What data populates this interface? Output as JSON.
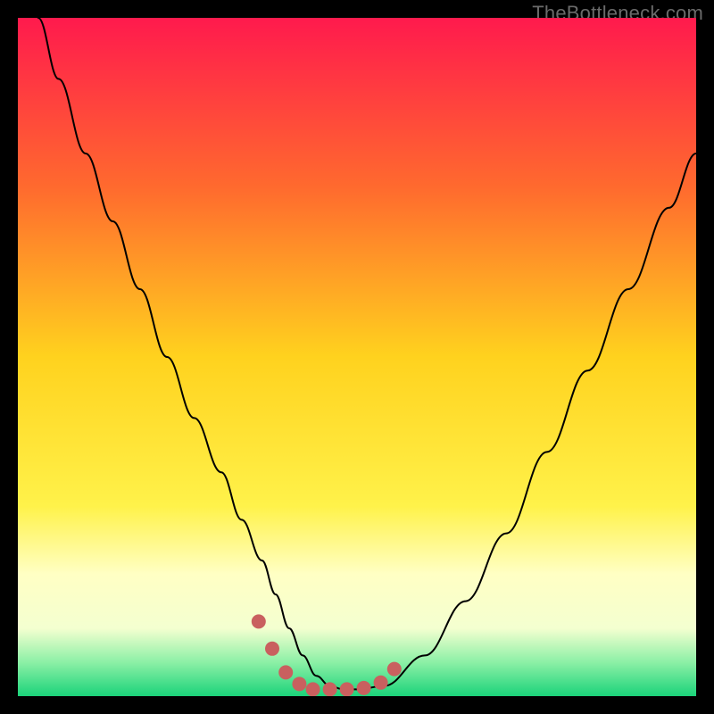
{
  "watermark": "TheBottleneck.com",
  "chart_data": {
    "type": "line",
    "title": "",
    "xlabel": "",
    "ylabel": "",
    "xlim": [
      0,
      100
    ],
    "ylim": [
      0,
      100
    ],
    "grid": false,
    "legend": false,
    "background_gradient": [
      {
        "pos": 0.0,
        "color": "#ff1a4d"
      },
      {
        "pos": 0.25,
        "color": "#ff6a2e"
      },
      {
        "pos": 0.5,
        "color": "#ffd21e"
      },
      {
        "pos": 0.72,
        "color": "#fff24a"
      },
      {
        "pos": 0.82,
        "color": "#ffffc4"
      },
      {
        "pos": 0.9,
        "color": "#f4ffd0"
      },
      {
        "pos": 0.95,
        "color": "#8cf0a6"
      },
      {
        "pos": 1.0,
        "color": "#1bd37a"
      }
    ],
    "series": [
      {
        "name": "curve",
        "stroke": "#000000",
        "stroke_width": 2,
        "x": [
          3,
          6,
          10,
          14,
          18,
          22,
          26,
          30,
          33,
          36,
          38,
          40,
          42,
          44,
          46,
          48,
          50,
          54,
          60,
          66,
          72,
          78,
          84,
          90,
          96,
          100
        ],
        "y": [
          100,
          91,
          80,
          70,
          60,
          50,
          41,
          33,
          26,
          20,
          15,
          10,
          6,
          3,
          1.5,
          1,
          1,
          1.5,
          6,
          14,
          24,
          36,
          48,
          60,
          72,
          80
        ]
      }
    ],
    "markers": {
      "name": "highlight-points",
      "fill": "#c9605f",
      "radius": 8,
      "x": [
        35.5,
        37.5,
        39.5,
        41.5,
        43.5,
        46.0,
        48.5,
        51.0,
        53.5,
        55.5
      ],
      "y": [
        11.0,
        7.0,
        3.5,
        1.8,
        1.0,
        1.0,
        1.0,
        1.2,
        2.0,
        4.0
      ]
    }
  }
}
